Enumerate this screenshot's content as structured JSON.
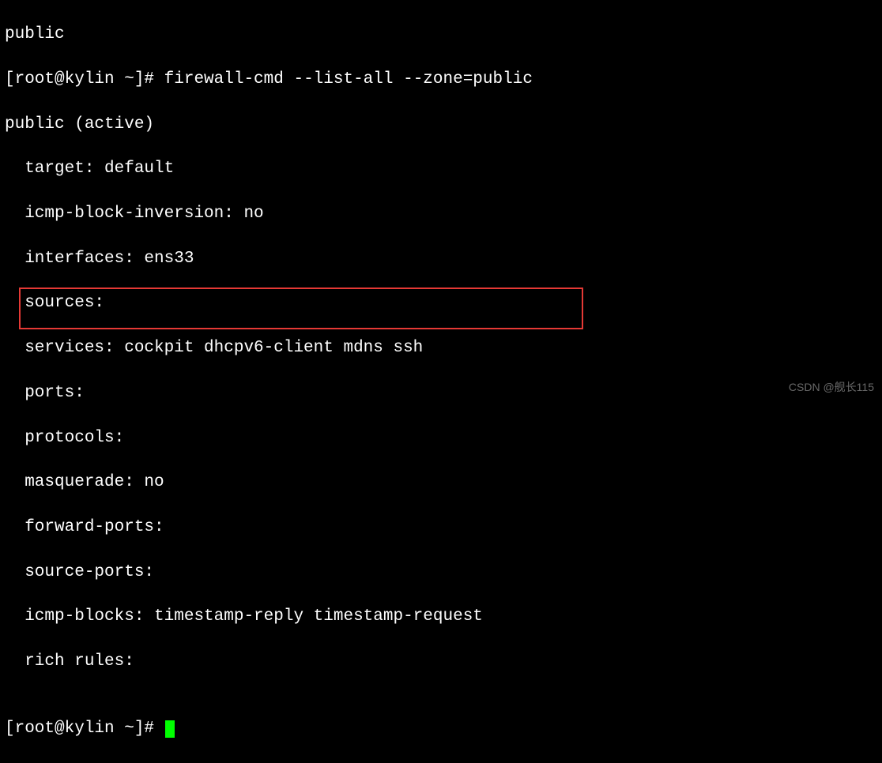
{
  "lines": {
    "l0": "public",
    "prompt1": "[root@kylin ~]# ",
    "cmd1": "firewall-cmd --list-all --zone=public",
    "l2": "public (active)",
    "l3": "  target: default",
    "l4": "  icmp-block-inversion: no",
    "l5": "  interfaces: ens33",
    "l6": "  sources:",
    "l7": "  services: cockpit dhcpv6-client mdns ssh",
    "l8": "  ports:",
    "l9": "  protocols:",
    "l10": "  masquerade: no",
    "l11": "  forward-ports:",
    "l12": "  source-ports:",
    "l13": "  icmp-blocks: timestamp-reply timestamp-request",
    "l14": "  rich rules:",
    "blank": "",
    "prompt2": "[root@kylin ~]# "
  },
  "watermark": "CSDN @舰长115"
}
